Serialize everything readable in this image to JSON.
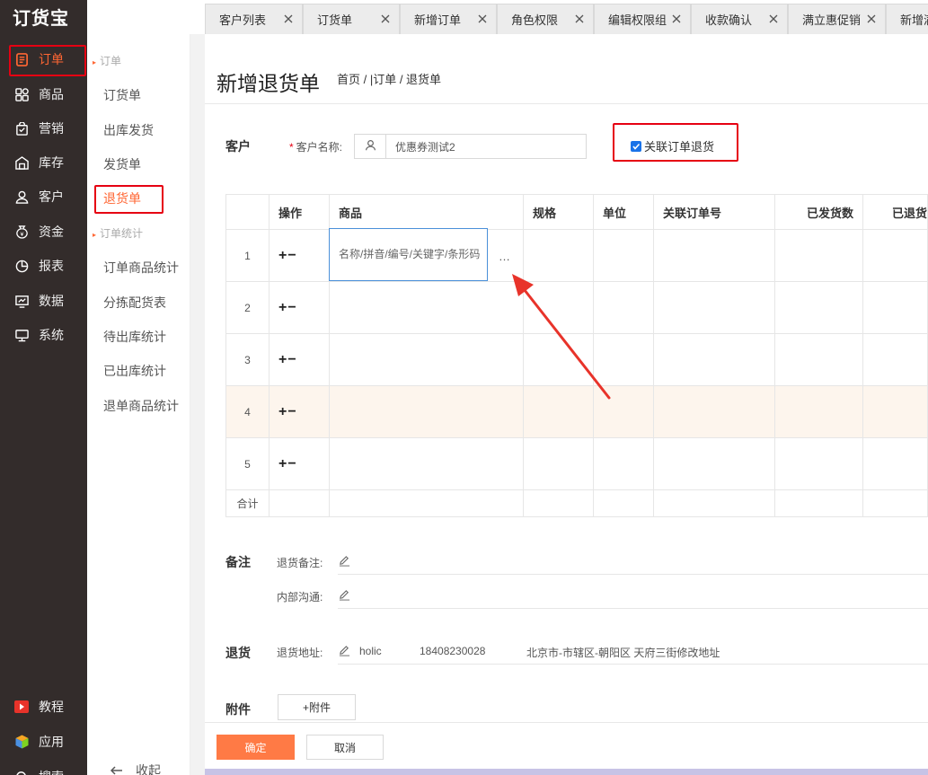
{
  "app": {
    "logo_text": "订货宝"
  },
  "sidebar": {
    "items": [
      {
        "label": "订单",
        "icon": "order-icon",
        "active": true
      },
      {
        "label": "商品",
        "icon": "grid-icon"
      },
      {
        "label": "营销",
        "icon": "bag-icon"
      },
      {
        "label": "库存",
        "icon": "warehouse-icon"
      },
      {
        "label": "客户",
        "icon": "user-icon"
      },
      {
        "label": "资金",
        "icon": "money-icon"
      },
      {
        "label": "报表",
        "icon": "pie-chart-icon"
      },
      {
        "label": "数据",
        "icon": "data-icon"
      },
      {
        "label": "系统",
        "icon": "monitor-icon"
      }
    ],
    "bottom_items": [
      {
        "label": "教程",
        "icon": "play-icon"
      },
      {
        "label": "应用",
        "icon": "cube-icon"
      },
      {
        "label": "搜索",
        "icon": "search-icon"
      }
    ],
    "accent": "#ff6633"
  },
  "subnav": {
    "group1": "订单",
    "group1_items": [
      "订货单",
      "出库发货",
      "发货单",
      "退货单"
    ],
    "group2": "订单统计",
    "group2_items": [
      "订单商品统计",
      "分拣配货表",
      "待出库统计",
      "已出库统计",
      "退单商品统计"
    ],
    "collapse_label": "收起"
  },
  "tabs": [
    "客户列表",
    "订货单",
    "新增订单",
    "角色权限",
    "编辑权限组",
    "收款确认",
    "满立惠促销",
    "新增满"
  ],
  "page": {
    "title": "新增退货单",
    "breadcrumb": "首页 / |订单 / 退货单"
  },
  "customer": {
    "section_label": "客户",
    "field_label": "客户名称:",
    "value": "优惠券测试2",
    "link_order_label": "关联订单退货",
    "link_order_checked": true
  },
  "goods_table": {
    "headers": [
      "",
      "操作",
      "商品",
      "规格",
      "单位",
      "关联订单号",
      "已发货数",
      "已退货"
    ],
    "rows": [
      "1",
      "2",
      "3",
      "4",
      "5"
    ],
    "ops_symbol": "+−",
    "goods_placeholder": "名称/拼音/编号/关键字/条形码（B",
    "more_symbol": "…",
    "total_label": "合计"
  },
  "remarks": {
    "section_label": "备注",
    "return_remark_label": "退货备注:",
    "internal_label": "内部沟通:"
  },
  "return_info": {
    "section_label": "退货",
    "address_label": "退货地址:",
    "contact_name": "holic",
    "phone": "18408230028",
    "address": "北京市-市辖区-朝阳区 天府三街修改地址"
  },
  "attachment": {
    "section_label": "附件",
    "button_label": "+附件"
  },
  "footer": {
    "confirm_label": "确定",
    "cancel_label": "取消"
  },
  "colors": {
    "highlight_border": "#e60012",
    "primary_button": "#ff7a45",
    "sidebar_bg": "#332c2b",
    "arrow": "#e8332a"
  }
}
